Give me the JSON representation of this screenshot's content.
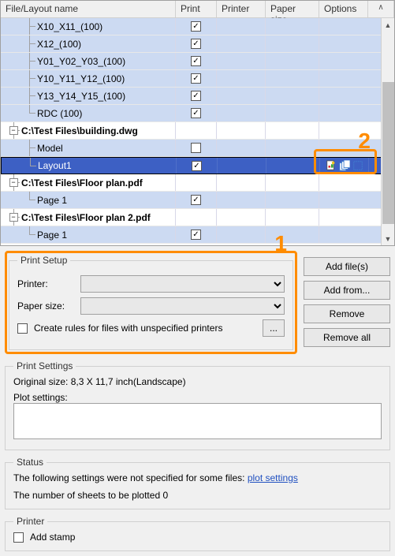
{
  "headers": {
    "file": "File/Layout name",
    "print": "Print",
    "printer": "Printer",
    "paper": "Paper size",
    "options": "Options",
    "spacer": "∧"
  },
  "rows": [
    {
      "type": "child",
      "name": "X10_X11_(100)",
      "print": true
    },
    {
      "type": "child",
      "name": "X12_(100)",
      "print": true
    },
    {
      "type": "child",
      "name": "Y01_Y02_Y03_(100)",
      "print": true
    },
    {
      "type": "child",
      "name": "Y10_Y11_Y12_(100)",
      "print": true
    },
    {
      "type": "child",
      "name": "Y13_Y14_Y15_(100)",
      "print": true
    },
    {
      "type": "child",
      "name": "RDC (100)",
      "print": true,
      "last": true
    },
    {
      "type": "group",
      "name": "C:\\Test Files\\building.dwg"
    },
    {
      "type": "child",
      "name": "Model",
      "print": false
    },
    {
      "type": "child",
      "name": "Layout1",
      "print": true,
      "last": true,
      "selected": true,
      "icons": true
    },
    {
      "type": "group",
      "name": "C:\\Test Files\\Floor plan.pdf"
    },
    {
      "type": "child",
      "name": "Page 1",
      "print": true,
      "last": true
    },
    {
      "type": "group",
      "name": "C:\\Test Files\\Floor plan 2.pdf"
    },
    {
      "type": "child",
      "name": "Page 1",
      "print": true,
      "last": true
    }
  ],
  "callouts": {
    "one": "1",
    "two": "2"
  },
  "printSetup": {
    "legend": "Print Setup",
    "printerLabel": "Printer:",
    "paperLabel": "Paper size:",
    "rulesLabel": "Create rules for files with unspecified printers",
    "ellipsis": "..."
  },
  "buttons": {
    "addFiles": "Add file(s)",
    "addFrom": "Add from...",
    "remove": "Remove",
    "removeAll": "Remove all"
  },
  "printSettings": {
    "legend": "Print Settings",
    "origSize": "Original size:  8,3 X 11,7 inch(Landscape)",
    "plotLabel": "Plot settings:"
  },
  "status": {
    "legend": "Status",
    "line1a": "The following settings were not specified for some files:",
    "link": "plot settings",
    "line2": "The number of sheets to be plotted 0"
  },
  "printer": {
    "legend": "Printer",
    "stamp": "Add stamp"
  }
}
